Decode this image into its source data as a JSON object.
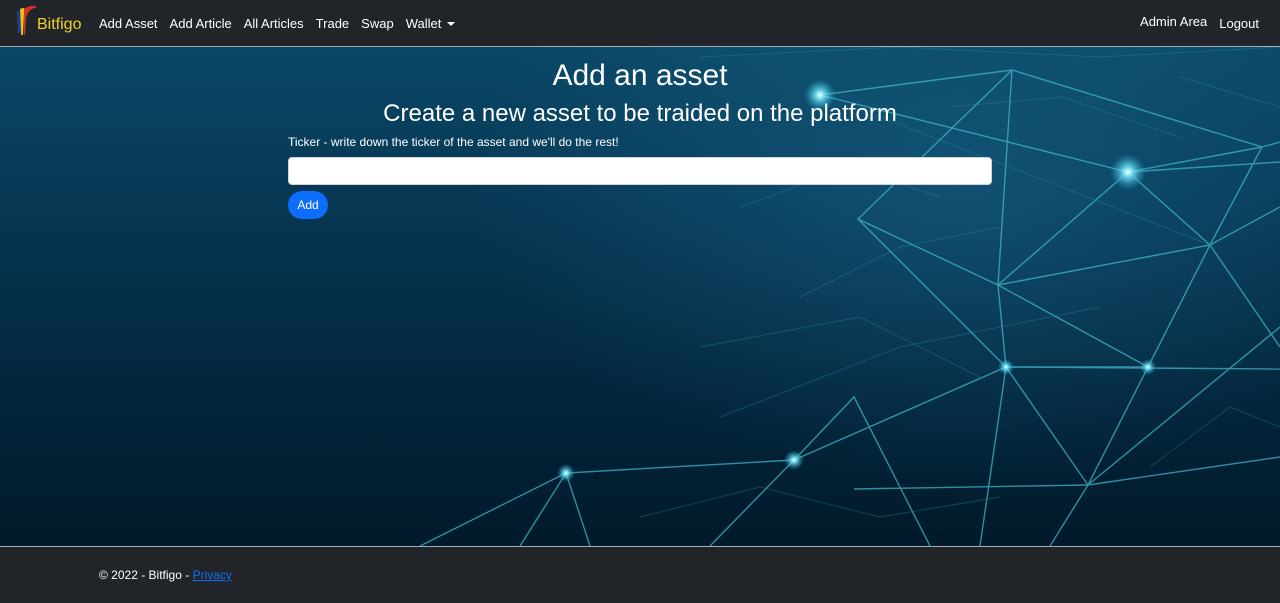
{
  "navbar": {
    "brand": "Bitfigo",
    "links": [
      "Add Asset",
      "Add Article",
      "All Articles",
      "Trade",
      "Swap"
    ],
    "wallet": "Wallet",
    "admin": "Admin Area",
    "logout": "Logout"
  },
  "main": {
    "title": "Add an asset",
    "subtitle": "Create a new asset to be traided on the platform",
    "ticker_label": "Ticker - write down the ticker of the asset and we'll do the rest!",
    "ticker_value": "",
    "add_label": "Add"
  },
  "footer": {
    "text": "© 2022 - Bitfigo - ",
    "privacy": "Privacy"
  },
  "colors": {
    "navbar_bg": "#212529",
    "accent": "#0d6efd",
    "brand_text": "#f0d22a",
    "network_line": "#3fb6c8"
  }
}
